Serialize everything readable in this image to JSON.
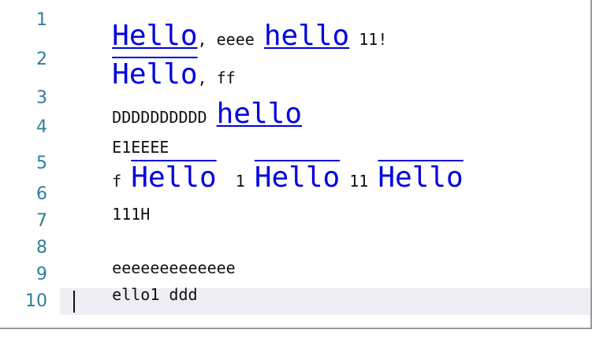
{
  "line_numbers": [
    "1",
    "2",
    "3",
    "4",
    "5",
    "6",
    "7",
    "8",
    "9",
    "10"
  ],
  "lines": {
    "l1": {
      "a": "Hello",
      "b": ", eeee ",
      "c": "hello",
      "d": " 11!"
    },
    "l2": {
      "a": "Hello",
      "b": ", ff"
    },
    "l3": {
      "a": "DDDDDDDDDD ",
      "b": "hello"
    },
    "l4": {
      "a": "E1EEEE"
    },
    "l5": {
      "a": "f ",
      "b": "Hello",
      "c": "  1 ",
      "d": "Hello",
      "e": " 11 ",
      "f": "Hello"
    },
    "l6": {
      "a": "111H"
    },
    "l7": {
      "a": ""
    },
    "l8": {
      "a": "eeeeeeeeeeeee"
    },
    "l9": {
      "a": "ello1 ddd"
    },
    "l10": {
      "a": ""
    }
  },
  "colors": {
    "link_blue": "#0000e0",
    "line_number": "#2f7e9a",
    "current_line_bg": "#eeeef4"
  }
}
